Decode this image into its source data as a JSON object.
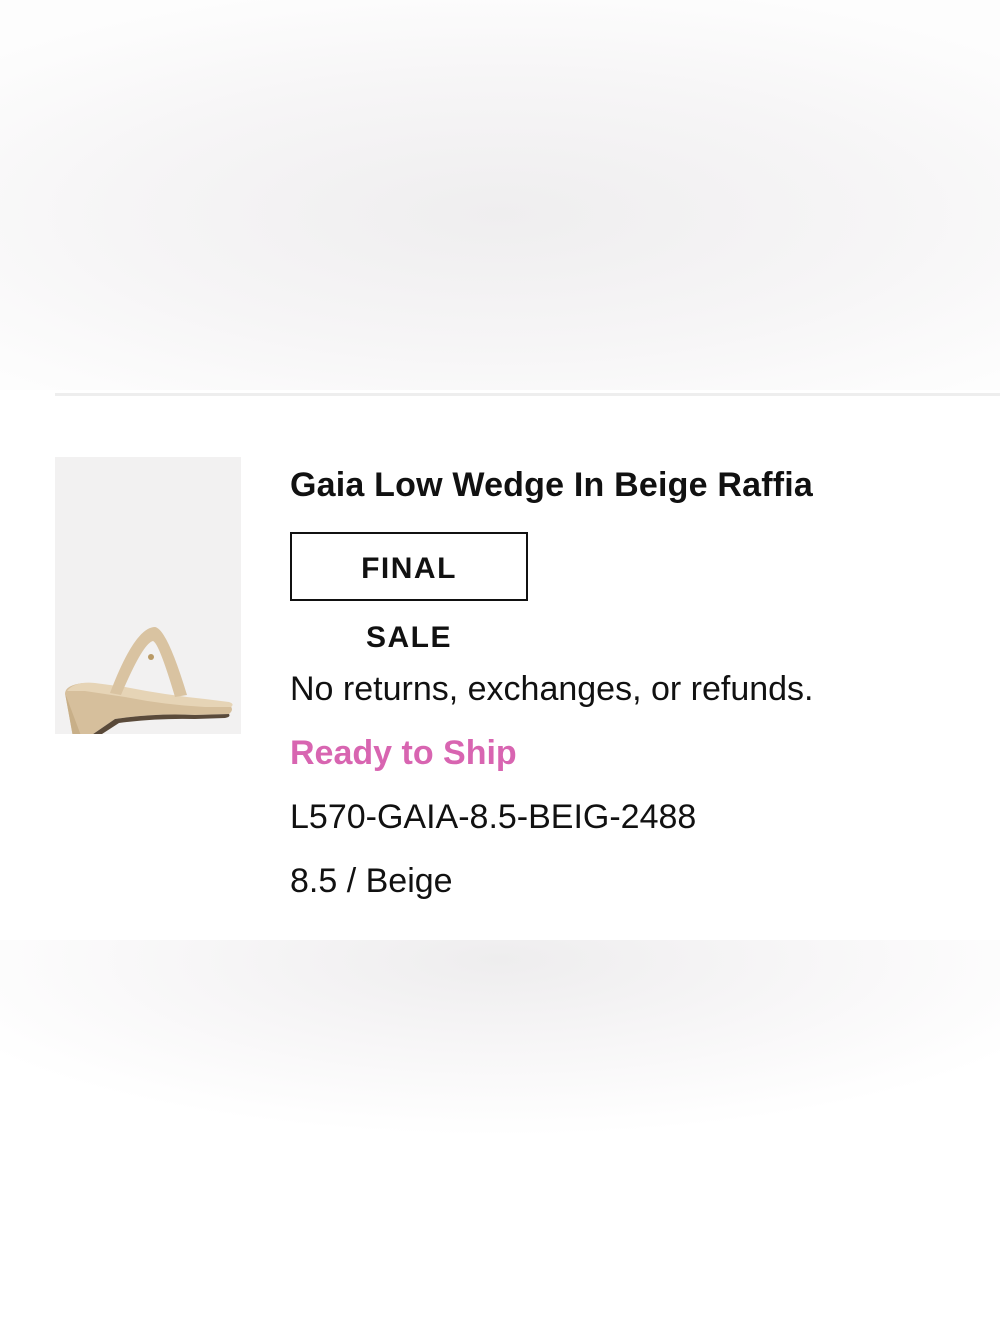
{
  "product": {
    "title": "Gaia Low Wedge In Beige Raffia",
    "badge": "FINAL SALE",
    "policy_note": "No returns, exchanges, or refunds.",
    "availability": "Ready to Ship",
    "sku": "L570-GAIA-8.5-BEIG-2488",
    "variant": "8.5 / Beige",
    "thumbnail_icon": "beige-wedge-sandal-image"
  },
  "colors": {
    "availability": "#d865b1",
    "thumbnail_bg": "#f2f1f1",
    "sandal": "#d9c3a1"
  }
}
